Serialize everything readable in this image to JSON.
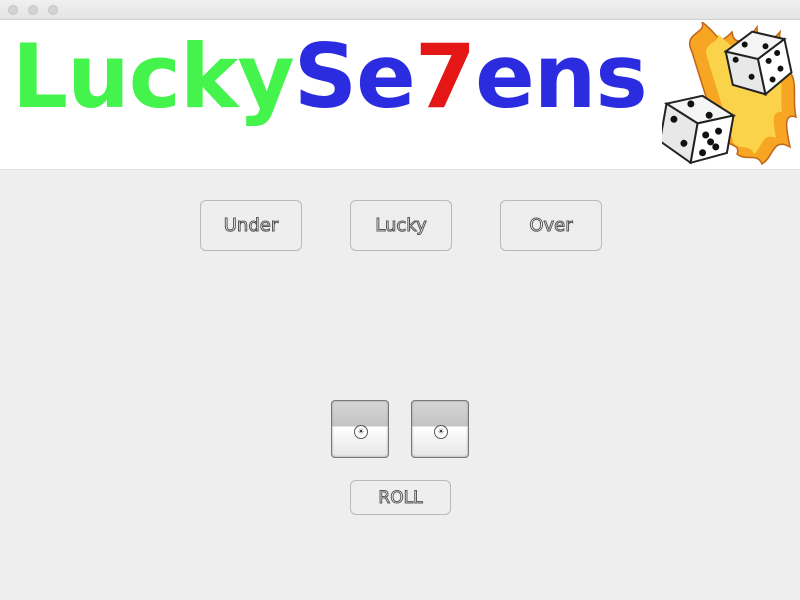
{
  "window": {
    "title": ""
  },
  "banner": {
    "logo_part1": "Lucky",
    "logo_part2": "Se",
    "logo_part3": "7",
    "logo_part4": "ens",
    "colors": {
      "lucky": "#44f44d",
      "sevens": "#2b2be0",
      "seven_digit": "#e41616"
    },
    "art": "flaming-dice-icon"
  },
  "bets": {
    "under_label": "Under",
    "lucky_label": "Lucky",
    "over_label": "Over"
  },
  "dice": {
    "die1_icon": "die-face-icon",
    "die2_icon": "die-face-icon"
  },
  "controls": {
    "roll_label": "ROLL"
  }
}
